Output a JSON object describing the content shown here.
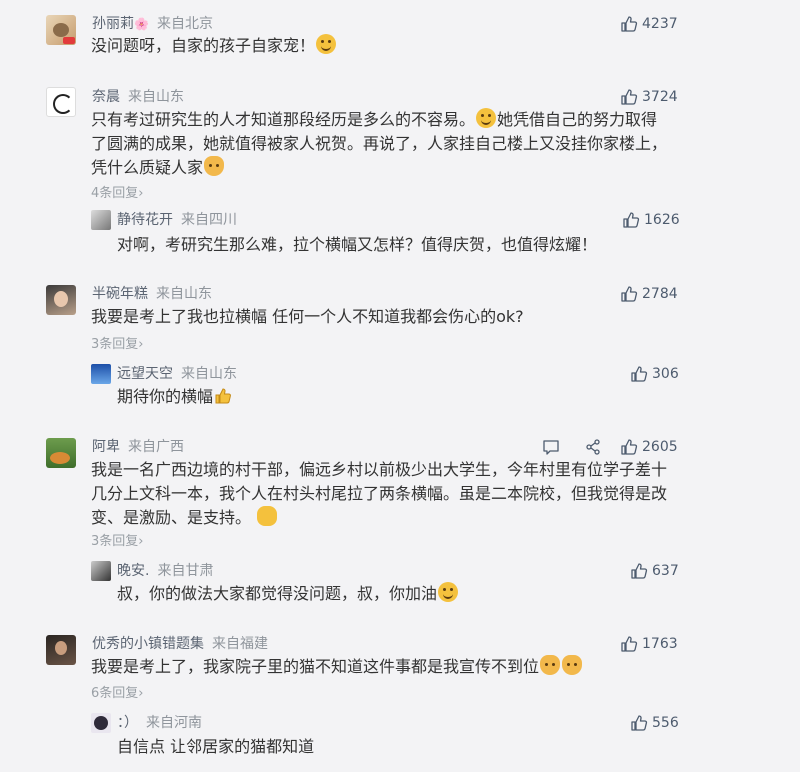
{
  "comments": [
    {
      "user": "孙丽莉",
      "badge": "🌸",
      "location": "来自北京",
      "likes": "4237",
      "lines": [
        "没问题呀，自家的孩子自家宠！"
      ],
      "emoji_end": "grin"
    },
    {
      "user": "奈晨",
      "location": "来自山东",
      "likes": "3724",
      "lines": [
        "只有考过研究生的人才知道那段经历是多么的不容易。",
        "她凭借自己的努力取得",
        "了圆满的成果，她就值得被家人祝贺。再说了，人家挂自己楼上又没挂你家楼上，",
        "凭什么质疑人家"
      ],
      "replies_label": "4条回复",
      "reply": {
        "user": "静待花开",
        "location": "来自四川",
        "likes": "1626",
        "text": "对啊，考研究生那么难，拉个横幅又怎样？值得庆贺，也值得炫耀！"
      }
    },
    {
      "user": "半碗年糕",
      "location": "来自山东",
      "likes": "2784",
      "lines": [
        "我要是考上了我也拉横幅 任何一个人不知道我都会伤心的ok?"
      ],
      "replies_label": "3条回复",
      "reply": {
        "user": "远望天空",
        "location": "来自山东",
        "likes": "306",
        "text": "期待你的横幅"
      }
    },
    {
      "user": "阿卑",
      "location": "来自广西",
      "likes": "2605",
      "lines": [
        "我是一名广西边境的村干部，偏远乡村以前极少出大学生，今年村里有位学子差十",
        "几分上文科一本，我个人在村头村尾拉了两条横幅。虽是二本院校，但我觉得是改",
        "变、是激励、是支持。"
      ],
      "replies_label": "3条回复",
      "reply": {
        "user": "晚安.",
        "location": "来自甘肃",
        "likes": "637",
        "text": "叔，你的做法大家都觉得没问题，叔，你加油"
      }
    },
    {
      "user": "优秀的小镇错题集",
      "location": "来自福建",
      "likes": "1763",
      "lines": [
        "我要是考上了，我家院子里的猫不知道这件事都是我宣传不到位"
      ],
      "replies_label": "6条回复",
      "reply": {
        "user": "：）",
        "location": "来自河南",
        "likes": "556",
        "text": "自信点 让邻居家的猫都知道"
      }
    }
  ],
  "colors": {
    "background": "#f3f3f5",
    "text": "#333333",
    "meta": "#8f959c",
    "like": "#4d5b6e",
    "accent": "#f4c13d"
  }
}
